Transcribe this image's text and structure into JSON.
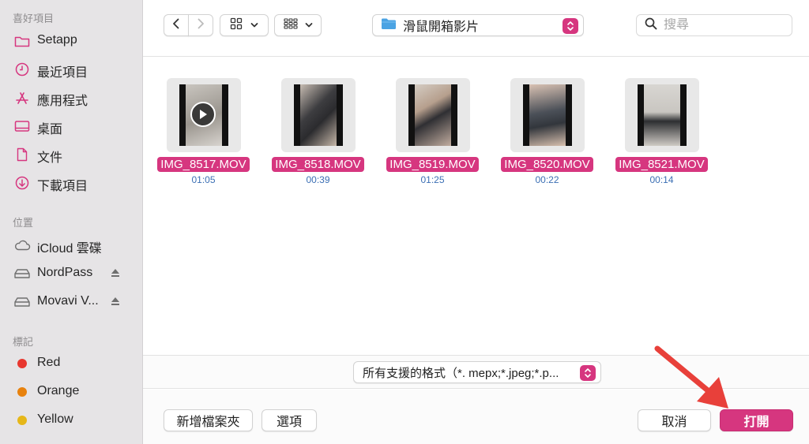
{
  "sidebar": {
    "favorites_title": "喜好項目",
    "favorites": [
      {
        "label": "Setapp",
        "icon": "folder-icon"
      },
      {
        "label": "最近項目",
        "icon": "clock-icon"
      },
      {
        "label": "應用程式",
        "icon": "applications-icon"
      },
      {
        "label": "桌面",
        "icon": "desktop-icon"
      },
      {
        "label": "文件",
        "icon": "document-icon"
      },
      {
        "label": "下載項目",
        "icon": "download-icon"
      }
    ],
    "locations_title": "位置",
    "locations": [
      {
        "label": "iCloud 雲碟",
        "icon": "cloud-icon"
      },
      {
        "label": "NordPass",
        "icon": "drive-icon"
      },
      {
        "label": "Movavi V...",
        "icon": "drive-icon"
      }
    ],
    "tags_title": "標記",
    "tags": [
      {
        "label": "Red",
        "color": "#e8372f"
      },
      {
        "label": "Orange",
        "color": "#e8820e"
      },
      {
        "label": "Yellow",
        "color": "#e6b719"
      }
    ]
  },
  "toolbar": {
    "path_label": "滑鼠開箱影片",
    "search_placeholder": "搜尋"
  },
  "files": [
    {
      "name": "IMG_8517.MOV",
      "duration": "01:05"
    },
    {
      "name": "IMG_8518.MOV",
      "duration": "00:39"
    },
    {
      "name": "IMG_8519.MOV",
      "duration": "01:25"
    },
    {
      "name": "IMG_8520.MOV",
      "duration": "00:22"
    },
    {
      "name": "IMG_8521.MOV",
      "duration": "00:14"
    }
  ],
  "format_bar": {
    "selected": "所有支援的格式（*. mepx;*.jpeg;*.p..."
  },
  "buttons": {
    "new_folder": "新增檔案夾",
    "options": "選項",
    "cancel": "取消",
    "open": "打開"
  },
  "colors": {
    "accent": "#d6367f",
    "sidebar_bg": "#e6e4e6",
    "annotation_arrow": "#e8403a"
  }
}
